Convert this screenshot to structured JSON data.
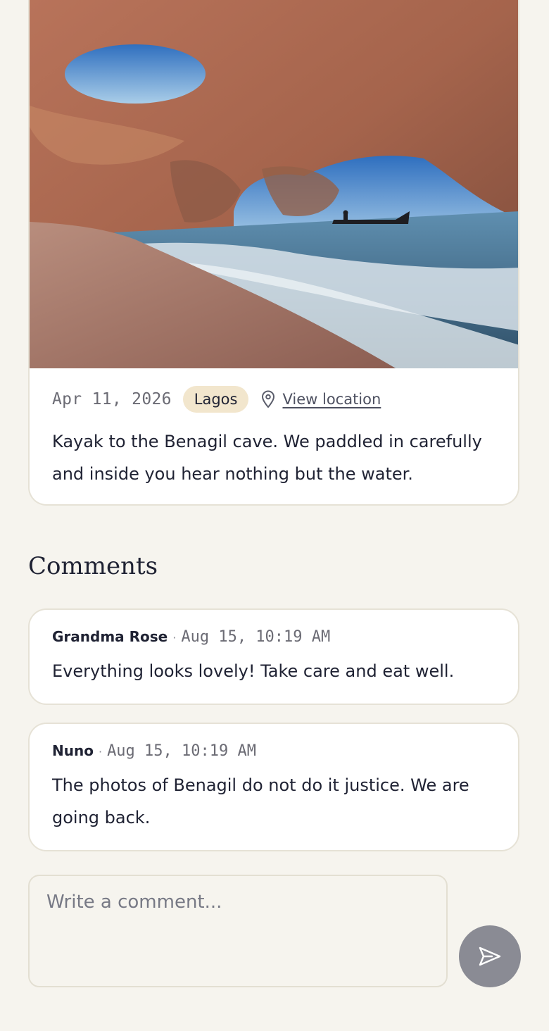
{
  "post": {
    "date": "Apr 11, 2026",
    "tag": "Lagos",
    "location_link": "View location",
    "text": "Kayak to the Benagil cave. We paddled in carefully and inside you hear nothing but the water."
  },
  "comments": {
    "title": "Comments",
    "items": [
      {
        "author": "Grandma Rose",
        "separator": "·",
        "time": "Aug 15, 10:19 AM",
        "text": "Everything looks lovely! Take care and eat well."
      },
      {
        "author": "Nuno",
        "separator": "·",
        "time": "Aug 15, 10:19 AM",
        "text": "The photos of Benagil do not do it justice. We are going back."
      }
    ]
  },
  "composer": {
    "placeholder": "Write a comment...",
    "value": ""
  },
  "icons": {
    "location": "map-pin-icon",
    "send": "send-icon"
  },
  "colors": {
    "background": "#f6f4ee",
    "card": "#ffffff",
    "border": "#e6e2d6",
    "tag_bg": "#f2e6cd",
    "send_button": "#8a8b94",
    "text": "#1f2233"
  }
}
